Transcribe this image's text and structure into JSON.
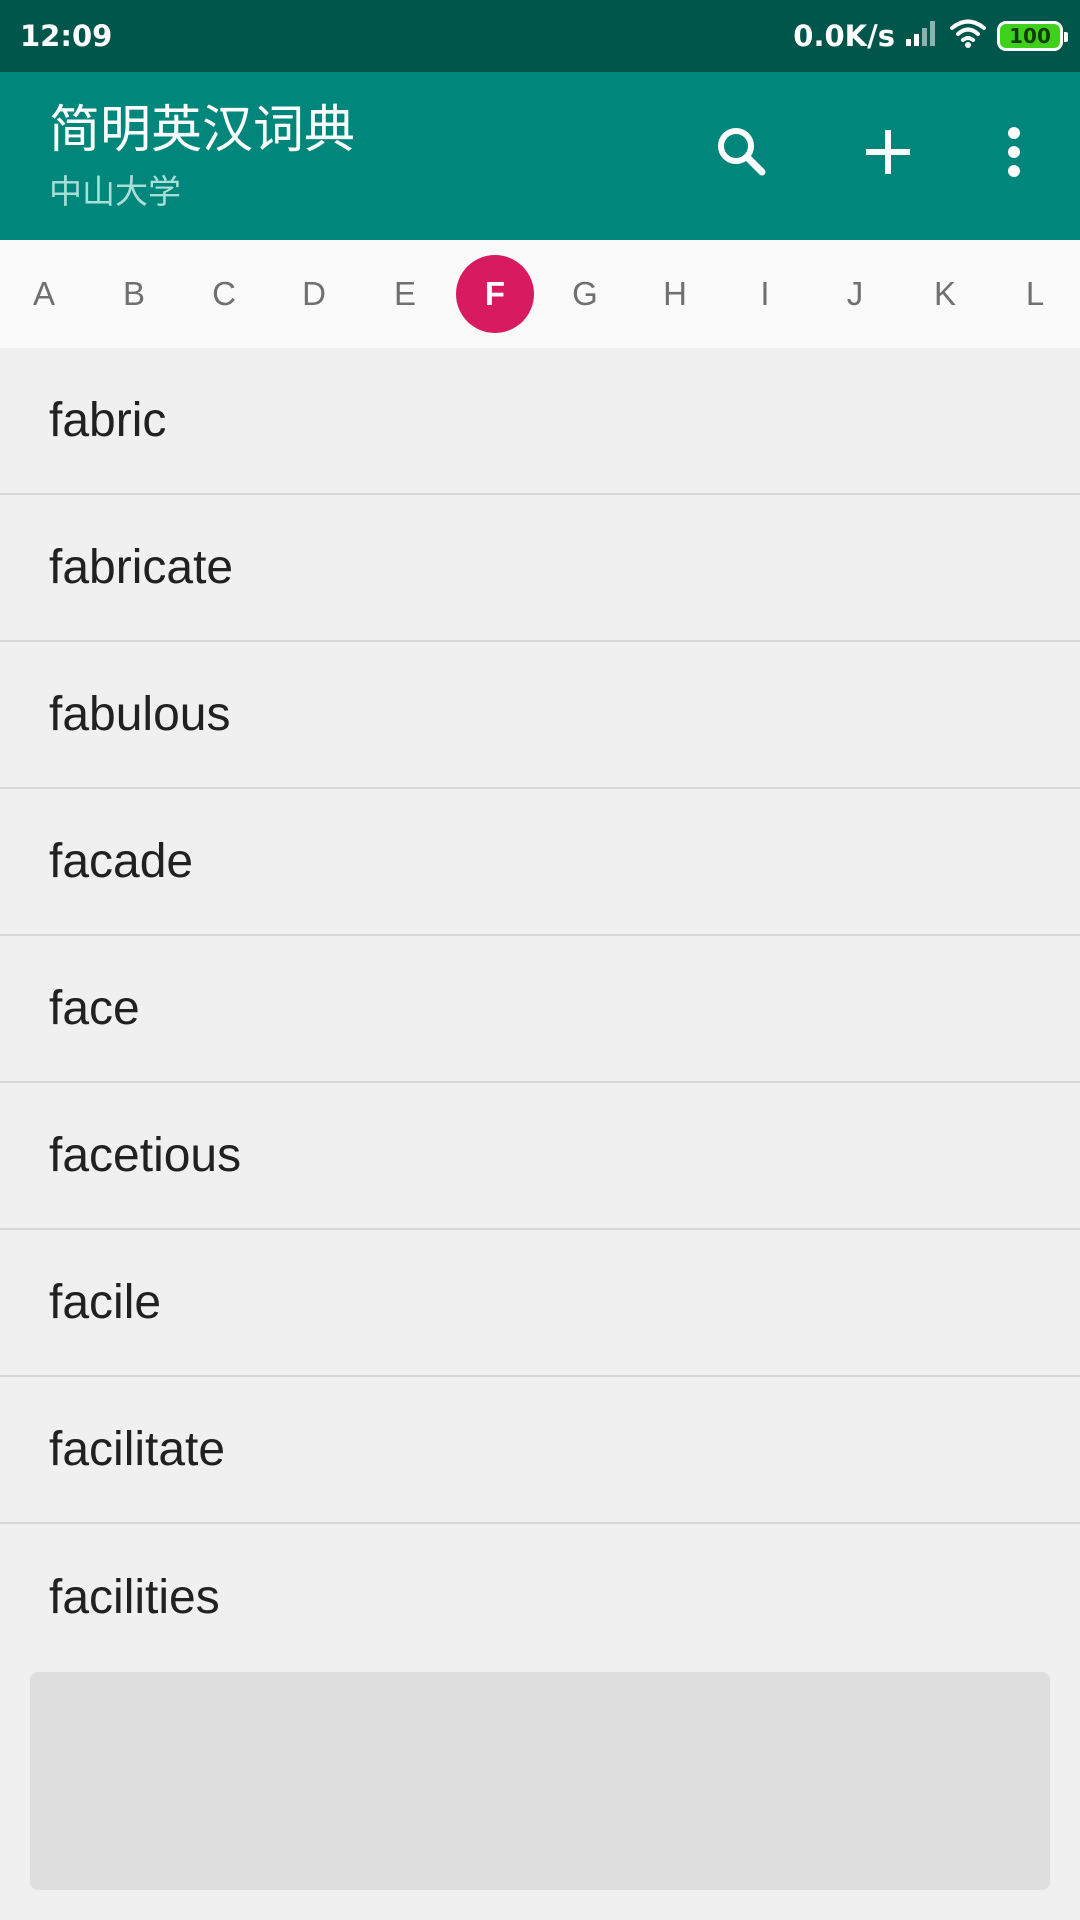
{
  "status_bar": {
    "time": "12:09",
    "net_speed": "0.0K/s",
    "battery": "100",
    "icons": [
      "signal-icon",
      "wifi-icon",
      "battery-icon"
    ]
  },
  "app_bar": {
    "title": "简明英汉词典",
    "subtitle": "中山大学",
    "actions": [
      "search-icon",
      "add-icon",
      "more-vert-icon"
    ]
  },
  "alphabet": {
    "letters": [
      "A",
      "B",
      "C",
      "D",
      "E",
      "F",
      "G",
      "H",
      "I",
      "J",
      "K",
      "L"
    ],
    "selected": "F",
    "selected_color": "#d81b60"
  },
  "words": [
    "fabric",
    "fabricate",
    "fabulous",
    "facade",
    "face",
    "facetious",
    "facile",
    "facilitate",
    "facilities"
  ],
  "colors": {
    "status_bar": "#00564b",
    "app_bar": "#00867a",
    "list_background": "#f0f0f0"
  }
}
